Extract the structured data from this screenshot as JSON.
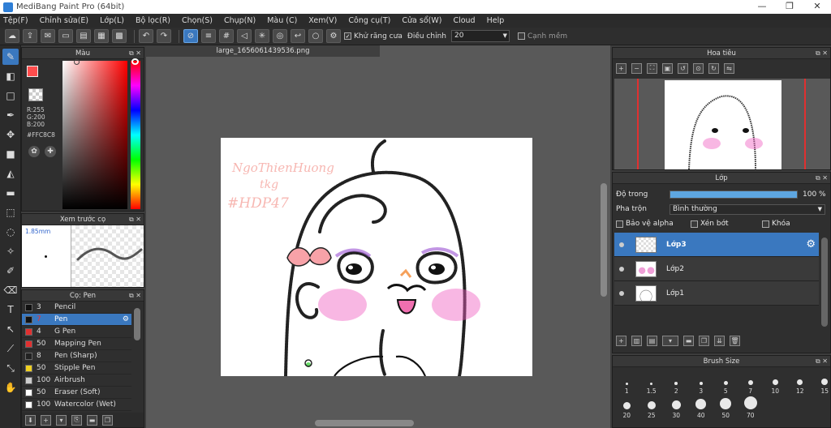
{
  "window": {
    "title": "MediBang Paint Pro (64bit)",
    "controls": [
      "—",
      "❐",
      "✕"
    ]
  },
  "menu": [
    "Tệp(F)",
    "Chỉnh sửa(E)",
    "Lớp(L)",
    "Bộ lọc(R)",
    "Chọn(S)",
    "Chụp(N)",
    "Màu (C)",
    "Xem(V)",
    "Công cụ(T)",
    "Cửa sổ(W)",
    "Cloud",
    "Help"
  ],
  "toolbar": {
    "antialias_label": "Khử răng cưa",
    "adjust_label": "Điều chỉnh",
    "adjust_value": "20",
    "smooth_label": "Cạnh mềm"
  },
  "color_panel": {
    "title": "Màu",
    "r": "R:255",
    "g": "G:200",
    "b": "B:200",
    "hex": "#FFC8C8",
    "fg": "#ff4d4d",
    "accent": "#3a78bf"
  },
  "brush_preview": {
    "title": "Xem trước cọ",
    "size": "1.85mm"
  },
  "brush_panel": {
    "title": "Cọ: Pen",
    "items": [
      {
        "size": "3",
        "name": "Pencil",
        "color": "#111111"
      },
      {
        "size": "7",
        "name": "Pen",
        "color": "#111111",
        "selected": true
      },
      {
        "size": "4",
        "name": "G Pen",
        "color": "#e03030"
      },
      {
        "size": "50",
        "name": "Mapping Pen",
        "color": "#e03030"
      },
      {
        "size": "8",
        "name": "Pen (Sharp)",
        "color": "#222222"
      },
      {
        "size": "50",
        "name": "Stipple Pen",
        "color": "#f0d020"
      },
      {
        "size": "100",
        "name": "Airbrush",
        "color": "#cccccc"
      },
      {
        "size": "50",
        "name": "Eraser (Soft)",
        "color": "#ffffff"
      },
      {
        "size": "100",
        "name": "Watercolor (Wet)",
        "color": "#ffffff"
      }
    ]
  },
  "document": {
    "tab": "large_1656061439536.png",
    "handwriting": [
      "NgoThienHuong",
      "tkg",
      "#HDP47"
    ]
  },
  "navigator": {
    "title": "Hoa tiêu"
  },
  "layers": {
    "title": "Lớp",
    "opacity_label": "Độ trong",
    "opacity_value": "100 %",
    "opacity_fraction": 1.0,
    "blend_label": "Pha trộn",
    "blend_value": "Bình thường",
    "protect_alpha": "Bảo vệ alpha",
    "clipping": "Xén bớt",
    "lock": "Khóa",
    "items": [
      {
        "name": "Lớp3",
        "selected": true
      },
      {
        "name": "Lớp2",
        "selected": false
      },
      {
        "name": "Lớp1",
        "selected": false
      }
    ]
  },
  "brush_size": {
    "title": "Brush Size",
    "sizes": [
      "1",
      "1.5",
      "2",
      "3",
      "5",
      "7",
      "10",
      "12",
      "15",
      "20",
      "25",
      "30",
      "40",
      "50",
      "70"
    ]
  }
}
